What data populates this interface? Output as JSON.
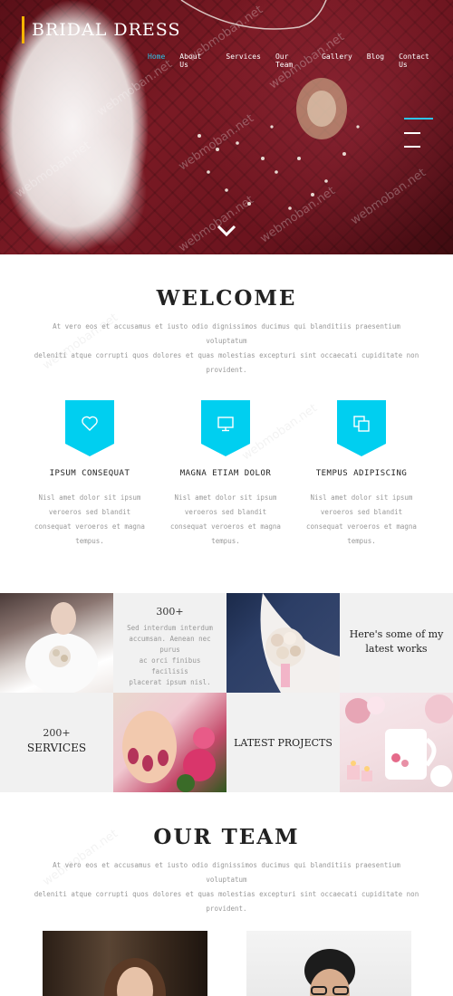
{
  "brand": {
    "logo": "BRIDAL DRESS",
    "accent": "#2ec4e8",
    "logo_bar": "#f5b400"
  },
  "nav": {
    "items": [
      "Home",
      "About Us",
      "Services",
      "Our Team",
      "Gallery",
      "Blog",
      "Contact Us"
    ],
    "active": "Home"
  },
  "hero": {
    "watermark": "webmoban.net"
  },
  "welcome": {
    "title": "WELCOME",
    "line1": "At vero eos et accusamus et iusto odio dignissimos ducimus qui blanditiis praesentium voluptatum",
    "line2": "deleniti atque corrupti quos dolores et quas molestias excepturi sint occaecati cupiditate non",
    "line3": "provident."
  },
  "features": [
    {
      "icon": "heart-icon",
      "title": "IPSUM CONSEQUAT",
      "l1": "Nisl amet dolor sit ipsum",
      "l2": "veroeros sed blandit",
      "l3": "consequat veroeros et magna",
      "l4": "tempus."
    },
    {
      "icon": "monitor-icon",
      "title": "MAGNA ETIAM DOLOR",
      "l1": "Nisl amet dolor sit ipsum",
      "l2": "veroeros sed blandit",
      "l3": "consequat veroeros et magna",
      "l4": "tempus."
    },
    {
      "icon": "copy-icon",
      "title": "TEMPUS ADIPISCING",
      "l1": "Nisl amet dolor sit ipsum",
      "l2": "veroeros sed blandit",
      "l3": "consequat veroeros et magna",
      "l4": "tempus."
    }
  ],
  "grid": {
    "stat1": {
      "num": "300+",
      "l1": "Sed interdum interdum",
      "l2": "accumsan. Aenean nec purus",
      "l3": "ac orci finibus facilisis",
      "l4": "placerat ipsum nisl."
    },
    "works": {
      "l1": "Here's some of my",
      "l2": "latest works"
    },
    "stat2": {
      "num": "200+",
      "label": "SERVICES"
    },
    "projects": "LATEST PROJECTS"
  },
  "team": {
    "title": "OUR TEAM",
    "line1": "At vero eos et accusamus et iusto odio dignissimos ducimus qui blanditiis praesentium voluptatum",
    "line2": "deleniti atque corrupti quos dolores et quas molestias excepturi sint occaecati cupiditate non",
    "line3": "provident."
  }
}
